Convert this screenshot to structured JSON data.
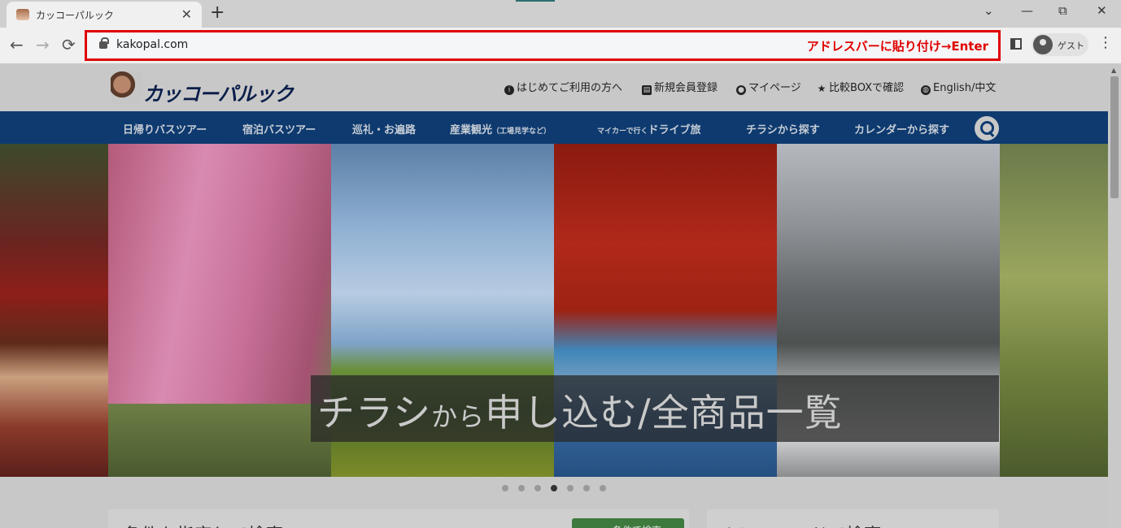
{
  "browser": {
    "tab_title": "カッコーパルック",
    "tab_close": "✕",
    "new_tab": "+",
    "window_controls": {
      "dropdown": "⌄",
      "minimize": "—",
      "restore": "⧉",
      "close": "✕"
    },
    "nav": {
      "back": "←",
      "forward": "→",
      "reload": "⟳"
    },
    "url": "kakopal.com",
    "address_annotation": "アドレスバーに貼り付け→Enter",
    "profile_label": "ゲスト",
    "menu": "⋮"
  },
  "site": {
    "logo_text": "カッコーパルック",
    "top_links": [
      {
        "icon": "info-icon",
        "glyph": "i",
        "label": "はじめてご利用の方へ"
      },
      {
        "icon": "card-icon",
        "glyph": "▤",
        "label": "新規会員登録"
      },
      {
        "icon": "user-icon",
        "glyph": "●",
        "label": "マイページ"
      },
      {
        "icon": "star-icon",
        "glyph": "★",
        "label": "比較BOXで確認"
      },
      {
        "icon": "globe-icon",
        "glyph": "◍",
        "label": "English/中文"
      }
    ],
    "global_nav": [
      {
        "label": "日帰りバスツアー"
      },
      {
        "label": "宿泊バスツアー"
      },
      {
        "label": "巡礼・お遍路"
      },
      {
        "label": "産業観光",
        "sub": "（工場見学など）"
      },
      {
        "label": "ドライブ旅",
        "pre": "マイカーで行く"
      },
      {
        "label": "チラシから探す"
      },
      {
        "label": "カレンダーから探す"
      }
    ],
    "hero": {
      "banner_main1": "チラシ",
      "banner_small": "から",
      "banner_main2": "申し込む/全商品一覧",
      "slides_total": 7,
      "active_slide": 4
    },
    "cards": {
      "left_heading": "条件を指定して検索",
      "left_button": "条件で検索",
      "right_heading": "ツアーコードで検索"
    }
  },
  "colors": {
    "annotation_red": "#e00000",
    "nav_blue": "#0e3a6f"
  }
}
